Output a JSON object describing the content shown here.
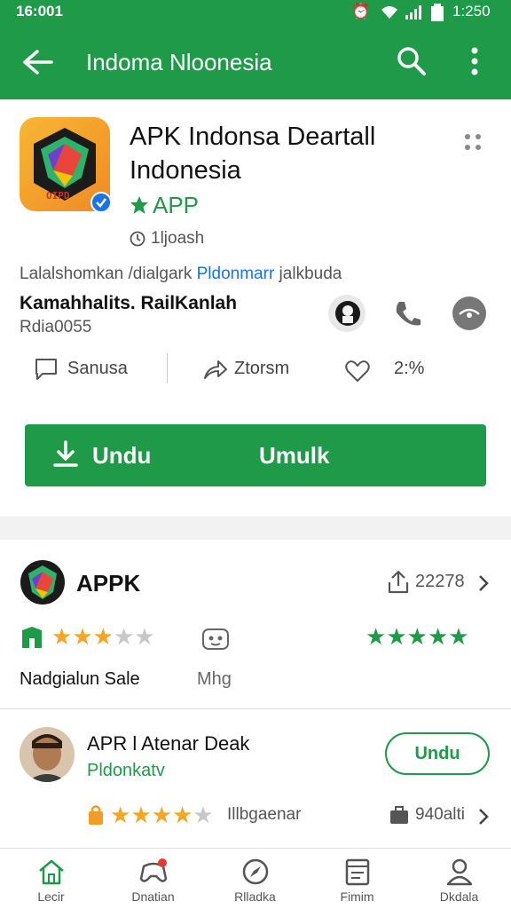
{
  "status": {
    "time": "16:001",
    "clock": "1:250"
  },
  "appbar": {
    "title": "Indoma Nloonesia"
  },
  "app": {
    "title_line1": "APK Indonsa Deartall",
    "title_line2": "Indonesia",
    "badge_text": "APP",
    "sub_text": "1ljoash",
    "desc_grey": "Lalalshomkan /dialgark ",
    "desc_blue": "Pldonmarr",
    "desc_tail": " jalkbuda",
    "dev_name": "Kamahhalits. RailKanlah",
    "dev_id": "Rdia0055",
    "icon_text": "OIPD"
  },
  "actions": {
    "share_label": "Sanusa",
    "forward_label": "Ztorsm",
    "like_value": "2:%"
  },
  "download": {
    "left_label": "Undu",
    "right_label": "Umulk"
  },
  "section2": {
    "title": "APPK",
    "count": "22278",
    "left_rating": 3,
    "right_rating": 5,
    "caption_left": "Nadgialun Sale",
    "caption_right": "Mhg"
  },
  "item": {
    "title": "APR l Atenar Deak",
    "subtitle": "Pldonkatv",
    "button_label": "Undu",
    "rating": 4,
    "rating_text": "Illbgaenar",
    "size_text": "940alti"
  },
  "nav": {
    "items": [
      {
        "label": "Lecir"
      },
      {
        "label": "Dnatian"
      },
      {
        "label": "Rlladka"
      },
      {
        "label": "Fimim"
      },
      {
        "label": "Dkdala"
      }
    ]
  },
  "colors": {
    "brand": "#1e9a48",
    "star_orange": "#f5a623",
    "star_grey": "#c8c8c8",
    "link_blue": "#1a73e8"
  }
}
